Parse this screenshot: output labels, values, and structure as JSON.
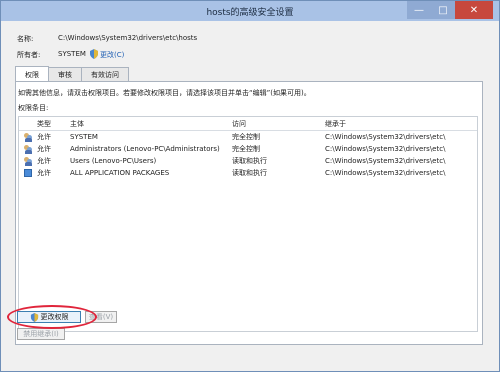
{
  "window": {
    "title": "hosts的高级安全设置",
    "controls": {
      "minimize": "—",
      "maximize": "□",
      "close": "✕"
    }
  },
  "header": {
    "name_label": "名称:",
    "name_value": "C:\\Windows\\System32\\drivers\\etc\\hosts",
    "owner_label": "所有者:",
    "owner_value": "SYSTEM",
    "owner_change": "更改(C)"
  },
  "tabs": [
    {
      "label": "权限"
    },
    {
      "label": "审核"
    },
    {
      "label": "有效访问"
    }
  ],
  "panel": {
    "hint": "如需其他信息，请双击权限项目。若要修改权限项目，请选择该项目并单击“编辑”(如果可用)。",
    "entries_title": "权限条目:"
  },
  "table": {
    "headers": {
      "type": "类型",
      "principal": "主体",
      "access": "访问",
      "inherited": "继承于"
    },
    "rows": [
      {
        "type": "允许",
        "principal": "SYSTEM",
        "access": "完全控制",
        "inherited": "C:\\Windows\\System32\\drivers\\etc\\",
        "icon": "user-group-icon"
      },
      {
        "type": "允许",
        "principal": "Administrators (Lenovo-PC\\Administrators)",
        "access": "完全控制",
        "inherited": "C:\\Windows\\System32\\drivers\\etc\\",
        "icon": "user-group-icon"
      },
      {
        "type": "允许",
        "principal": "Users (Lenovo-PC\\Users)",
        "access": "读取和执行",
        "inherited": "C:\\Windows\\System32\\drivers\\etc\\",
        "icon": "user-group-icon"
      },
      {
        "type": "允许",
        "principal": "ALL APPLICATION PACKAGES",
        "access": "读取和执行",
        "inherited": "C:\\Windows\\System32\\drivers\\etc\\",
        "icon": "package-icon"
      }
    ]
  },
  "buttons": {
    "change_permissions": "更改权限",
    "view": "查看(V)",
    "disable_inheritance": "禁用继承(I)"
  },
  "colors": {
    "accent": "#1f5fb3",
    "highlight": "#e0253b",
    "titlebar": "#a9c2e6"
  }
}
